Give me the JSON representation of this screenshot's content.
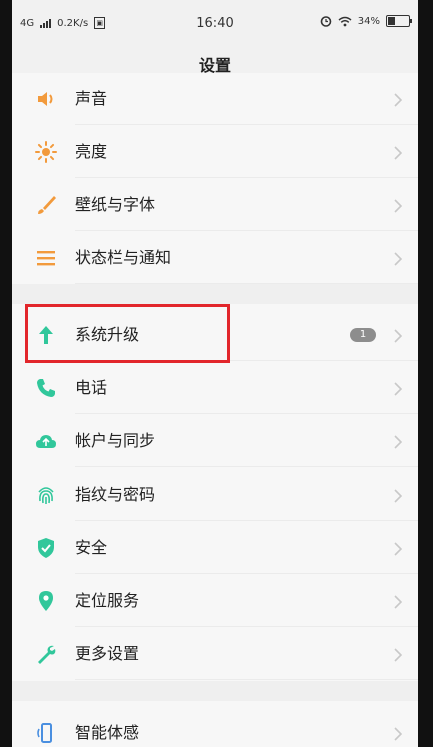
{
  "status_bar": {
    "network": "4G",
    "speed": "0.2K/s",
    "time": "16:40",
    "battery_percent": "34%",
    "battery_level": 0.34
  },
  "header": {
    "title": "设置"
  },
  "settings": {
    "items": [
      {
        "label": "声音",
        "icon": "speaker-icon",
        "color": "#f29a3c"
      },
      {
        "label": "亮度",
        "icon": "sun-icon",
        "color": "#f29a3c"
      },
      {
        "label": "壁纸与字体",
        "icon": "brush-icon",
        "color": "#f29a3c"
      },
      {
        "label": "状态栏与通知",
        "icon": "list-icon",
        "color": "#f29a3c"
      },
      {
        "label": "系统升级",
        "icon": "arrow-up-icon",
        "color": "#31c79b",
        "badge": "1"
      },
      {
        "label": "电话",
        "icon": "phone-icon",
        "color": "#31c79b"
      },
      {
        "label": "帐户与同步",
        "icon": "cloud-icon",
        "color": "#31c79b"
      },
      {
        "label": "指纹与密码",
        "icon": "fingerprint-icon",
        "color": "#31c79b"
      },
      {
        "label": "安全",
        "icon": "shield-icon",
        "color": "#31c79b"
      },
      {
        "label": "定位服务",
        "icon": "location-pin-icon",
        "color": "#31c79b"
      },
      {
        "label": "更多设置",
        "icon": "wrench-icon",
        "color": "#31c79b"
      },
      {
        "label": "智能体感",
        "icon": "phone-motion-icon",
        "color": "#4a8fe0"
      }
    ]
  },
  "colors": {
    "accent_orange": "#f29a3c",
    "accent_green": "#31c79b",
    "highlight_red": "#e2262b"
  }
}
